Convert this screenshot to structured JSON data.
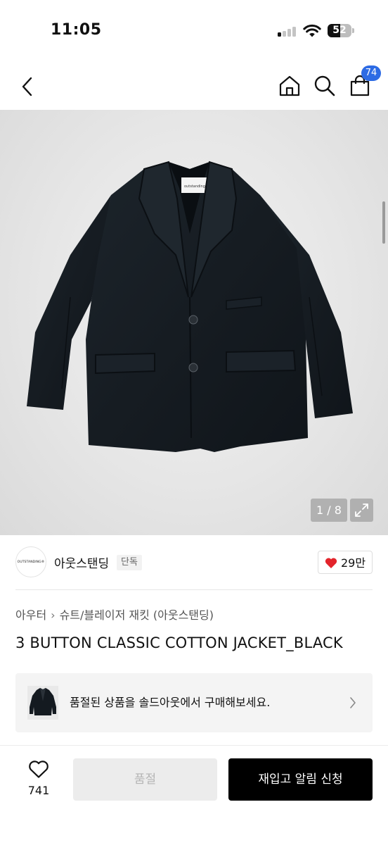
{
  "status_bar": {
    "time": "11:05",
    "battery_level": "52",
    "battery_percent": 52,
    "signal_bars_active": 1,
    "signal_bars_total": 4
  },
  "nav": {
    "back_icon": "chevron-left-icon",
    "home_icon": "home-icon",
    "search_icon": "search-icon",
    "cart_icon": "cart-icon",
    "cart_count": "74",
    "badge_color": "#2d6be4"
  },
  "gallery": {
    "counter": "1 / 8",
    "expand_icon": "expand-icon",
    "image_label": "outstanding"
  },
  "brand": {
    "logo_text": "OUTSTANDING®",
    "name": "아웃스탠딩",
    "tag": "단독",
    "like_count": "29만",
    "like_color": "#e3242b"
  },
  "breadcrumb": {
    "category": "아우터",
    "subcategory": "슈트/블레이저 재킷 (아웃스탠딩)"
  },
  "product": {
    "title": "3 BUTTON CLASSIC COTTON JACKET_BLACK"
  },
  "soldout_banner": {
    "text": "품절된 상품을 솔드아웃에서 구매해보세요."
  },
  "bottom_bar": {
    "wish_count": "741",
    "soldout_label": "품절",
    "notify_label": "재입고 알림 신청"
  }
}
